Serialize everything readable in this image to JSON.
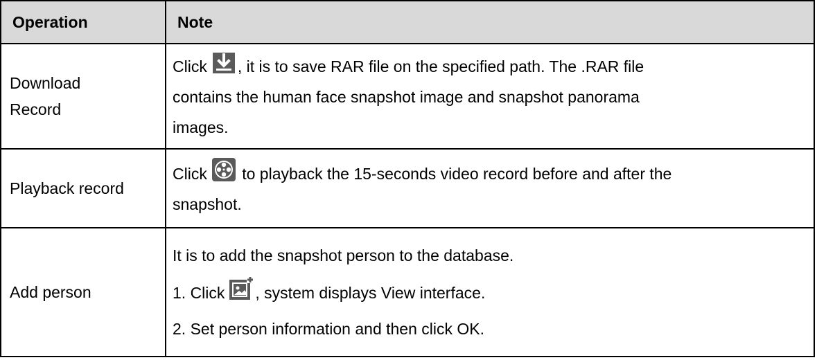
{
  "header": {
    "operation": "Operation",
    "note": "Note"
  },
  "rows": [
    {
      "operation_line1": "Download",
      "operation_line2": "Record",
      "icon": "download-icon",
      "note_before_icon": "Click",
      "note_after_icon": ", it is to save RAR file on the specified path. The .RAR file",
      "note_line2": "contains the human face snapshot image and snapshot panorama",
      "note_line3": "images."
    },
    {
      "operation": "Playback record",
      "icon": "film-reel-icon",
      "note_before_icon": "Click",
      "note_after_icon": " to playback the 15-seconds video record before and after the",
      "note_line2": "snapshot."
    },
    {
      "operation": "Add person",
      "icon": "add-person-image-icon",
      "note_line1": "It is to add the snapshot person to the database.",
      "note_before_icon": "1. Click",
      "note_after_icon": ", system displays View interface.",
      "note_line3": "2. Set person information and then click OK."
    }
  ],
  "colors": {
    "header_bg": "#d9d9d9",
    "icon_bg": "#5a5a5a",
    "icon_fg": "#ffffff",
    "border": "#000000"
  }
}
